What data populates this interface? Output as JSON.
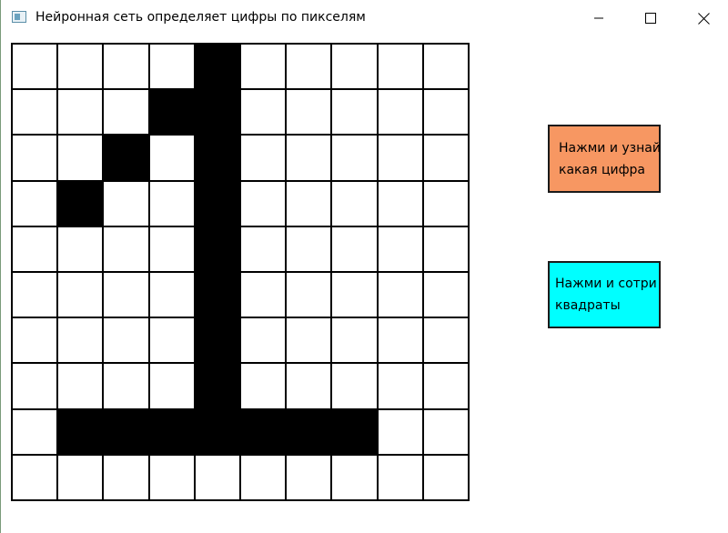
{
  "window": {
    "title": "Нейронная сеть определяет цифры по пикселям",
    "controls": {
      "minimize_icon": "minimize-icon",
      "maximize_icon": "maximize-icon",
      "close_icon": "close-icon"
    }
  },
  "grid": {
    "rows": 10,
    "cols": 10,
    "filled_color": "#000000",
    "empty_color": "#ffffff",
    "cells": [
      [
        0,
        0,
        0,
        0,
        1,
        0,
        0,
        0,
        0,
        0
      ],
      [
        0,
        0,
        0,
        1,
        1,
        0,
        0,
        0,
        0,
        0
      ],
      [
        0,
        0,
        1,
        0,
        1,
        0,
        0,
        0,
        0,
        0
      ],
      [
        0,
        1,
        0,
        0,
        1,
        0,
        0,
        0,
        0,
        0
      ],
      [
        0,
        0,
        0,
        0,
        1,
        0,
        0,
        0,
        0,
        0
      ],
      [
        0,
        0,
        0,
        0,
        1,
        0,
        0,
        0,
        0,
        0
      ],
      [
        0,
        0,
        0,
        0,
        1,
        0,
        0,
        0,
        0,
        0
      ],
      [
        0,
        0,
        0,
        0,
        1,
        0,
        0,
        0,
        0,
        0
      ],
      [
        0,
        1,
        1,
        1,
        1,
        1,
        1,
        1,
        0,
        0
      ],
      [
        0,
        0,
        0,
        0,
        0,
        0,
        0,
        0,
        0,
        0
      ]
    ]
  },
  "buttons": {
    "recognize": {
      "line1": "Нажми и узнай",
      "line2": "какая цифра",
      "color": "#f79762"
    },
    "clear": {
      "line1": "Нажми и сотри",
      "line2": "квадраты",
      "color": "#00ffff"
    }
  }
}
